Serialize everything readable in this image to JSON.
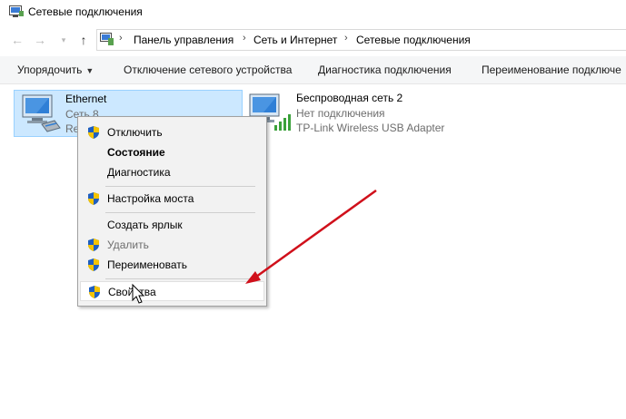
{
  "window": {
    "title": "Сетевые подключения"
  },
  "breadcrumb": {
    "items": [
      "Панель управления",
      "Сеть и Интернет",
      "Сетевые подключения"
    ]
  },
  "toolbar": {
    "organize": "Упорядочить",
    "disable_device": "Отключение сетевого устройства",
    "diagnose": "Диагностика подключения",
    "rename": "Переименование подключе"
  },
  "connections": [
    {
      "name": "Ethernet",
      "status": "Сеть 8",
      "adapter": "Re",
      "selected": true
    },
    {
      "name": "Беспроводная сеть 2",
      "status": "Нет подключения",
      "adapter": "TP-Link Wireless USB Adapter",
      "selected": false
    }
  ],
  "context_menu": {
    "items": [
      {
        "label": "Отключить",
        "icon": "uac-shield-icon"
      },
      {
        "label": "Состояние",
        "bold": true
      },
      {
        "label": "Диагностика"
      },
      {
        "label": "Настройка моста",
        "icon": "uac-shield-icon"
      },
      {
        "label": "Создать ярлык"
      },
      {
        "label": "Удалить",
        "icon": "uac-shield-icon",
        "disabled": true
      },
      {
        "label": "Переименовать",
        "icon": "uac-shield-icon"
      },
      {
        "label": "Свойства",
        "icon": "uac-shield-icon",
        "highlighted": true
      }
    ]
  },
  "colors": {
    "selection_bg": "#cce8ff",
    "selection_border": "#99d1ff",
    "toolbar_bg": "#f5f6f7",
    "annotation_arrow": "#d0101b"
  }
}
